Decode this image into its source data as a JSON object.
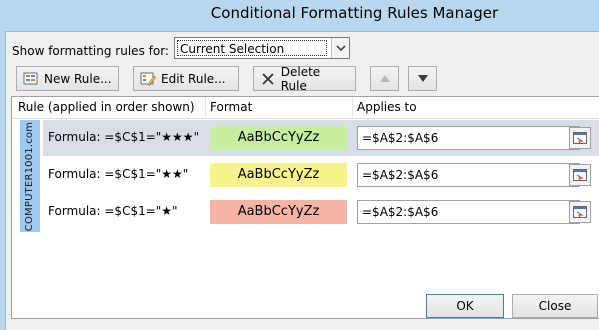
{
  "window": {
    "title": "Conditional Formatting Rules Manager"
  },
  "show": {
    "label": "Show formatting rules for:",
    "selected": "Current Selection"
  },
  "toolbar": {
    "new_rule": "New Rule...",
    "edit_rule": "Edit Rule...",
    "delete_rule": "Delete Rule"
  },
  "columns": {
    "rule": "Rule (applied in order shown)",
    "format": "Format",
    "applies_to": "Applies to"
  },
  "watermark": "COMPUTER1001.com",
  "rules": [
    {
      "condition": "Formula: =$C$1=\"★★★\"",
      "format_preview": "AaBbCcYyZz",
      "format_color": "#c6efa0",
      "applies_to": "=$A$2:$A$6"
    },
    {
      "condition": "Formula: =$C$1=\"★★\"",
      "format_preview": "AaBbCcYyZz",
      "format_color": "#f6f58c",
      "applies_to": "=$A$2:$A$6"
    },
    {
      "condition": "Formula: =$C$1=\"★\"",
      "format_preview": "AaBbCcYyZz",
      "format_color": "#f5b5a6",
      "applies_to": "=$A$2:$A$6"
    }
  ],
  "footer": {
    "ok": "OK",
    "close": "Close"
  }
}
